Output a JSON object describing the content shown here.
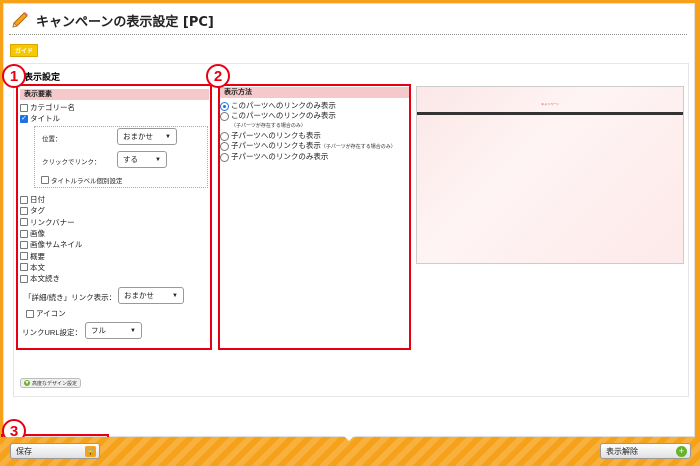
{
  "header": {
    "title": "キャンペーンの表示設定 [PC]",
    "guide_label": "ガイド"
  },
  "section": {
    "title": "表示設定"
  },
  "display_elements": {
    "header": "表示要素",
    "category_name": "カテゴリー名",
    "title": "タイトル",
    "position_label": "位置：",
    "position_value": "おまかせ",
    "click_link_label": "クリックでリンク：",
    "click_link_value": "する",
    "title_label_custom": "タイトルラベル個別設定",
    "items": [
      "日付",
      "タグ",
      "リンクバナー",
      "画像",
      "画像サムネイル",
      "概要",
      "本文",
      "本文続き"
    ],
    "detail_link_label": "「詳細/続き」リンク表示：",
    "detail_link_value": "おまかせ",
    "icon_label": "アイコン",
    "link_url_label": "リンクURL設定：",
    "link_url_value": "フル"
  },
  "display_method": {
    "header": "表示方法",
    "options": [
      {
        "label": "このパーツへのリンクのみ表示",
        "note": "",
        "selected": true
      },
      {
        "label": "このパーツへのリンクのみ表示",
        "note": "（子パーツが存在する場合のみ）",
        "selected": false
      },
      {
        "label": "子パーツへのリンクも表示",
        "note": "",
        "selected": false
      },
      {
        "label": "子パーツへのリンクも表示",
        "note": "（子パーツが存在する場合のみ）",
        "selected": false
      },
      {
        "label": "子パーツへのリンクのみ表示",
        "note": "",
        "selected": false
      }
    ]
  },
  "preview": {
    "title": "キャンペーン"
  },
  "advanced_design_label": "高度なデザイン設定",
  "footer": {
    "save_label": "保存",
    "hide_label": "表示解除"
  },
  "annotations": [
    "1",
    "2",
    "3"
  ],
  "colors": {
    "accent_orange": "#f6a11a",
    "annotation_red": "#e60012",
    "header_pink": "#f5c9c9"
  },
  "icons": [
    "pencil-icon",
    "lock-icon",
    "plus-icon",
    "down-arrow-icon",
    "chevron-down-icon"
  ]
}
